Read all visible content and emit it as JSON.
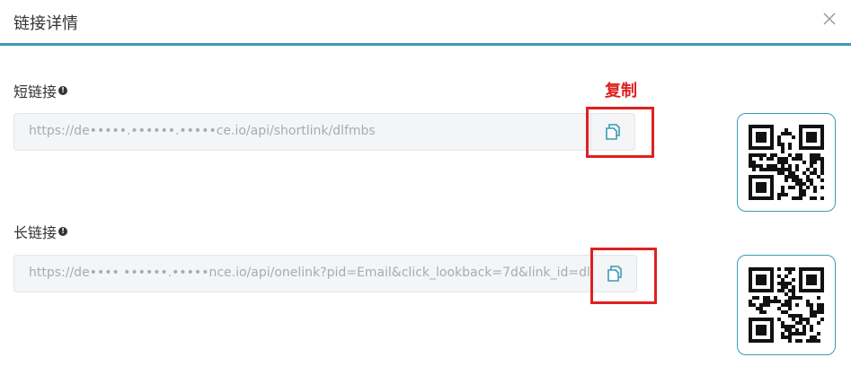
{
  "dialog": {
    "title": "链接详情",
    "close_icon": "close-icon"
  },
  "annotation": {
    "copy_label": "复制",
    "color": "#e02020"
  },
  "short_link": {
    "label": "短链接",
    "value": "https://de•••••.••••••.•••••ce.io/api/shortlink/dlfmbs",
    "copy_icon": "copy-icon",
    "qr_icon": "qr-code"
  },
  "long_link": {
    "label": "长链接",
    "value": "https://de•••• ••••••.•••••nce.io/api/onelink?pid=Email&click_lookback=7d&link_id=dlfmbs&io",
    "copy_icon": "copy-icon",
    "qr_icon": "qr-code"
  },
  "colors": {
    "accent": "#3a9bb5",
    "field_bg": "#f4f5f7",
    "placeholder_text": "#a8abb0"
  }
}
